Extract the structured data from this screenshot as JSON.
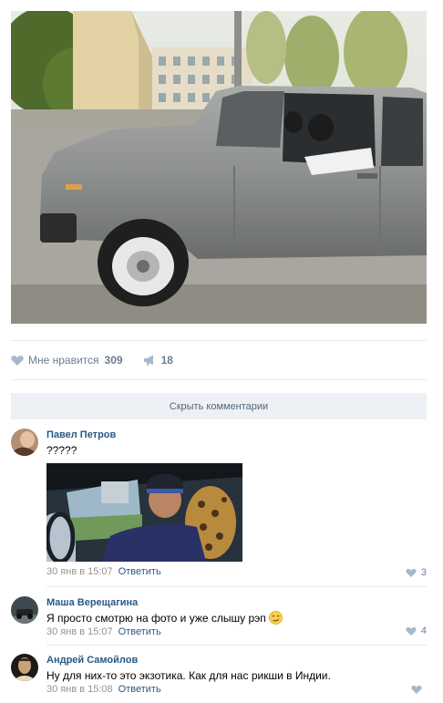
{
  "post": {
    "photo_icon": "post-photo-car",
    "likes_label": "Мне нравится",
    "likes_count": "309",
    "shares_count": "18"
  },
  "comments_toggle": "Скрыть комментарии",
  "comments": [
    {
      "author": "Павел Петров",
      "text": "?????",
      "date": "30 янв в 15:07",
      "reply": "Ответить",
      "likes": "3"
    },
    {
      "author": "Маша Верещагина",
      "text": "Я просто смотрю на фото и уже слышу рэп",
      "date": "30 янв в 15:07",
      "reply": "Ответить",
      "likes": "4"
    },
    {
      "author": "Андрей Самойлов",
      "text": "Ну для них-то это экзотика. Как для нас рикши в Индии.",
      "date": "30 янв в 15:08",
      "reply": "Ответить",
      "likes": ""
    }
  ],
  "colors": {
    "link": "#2a5885",
    "button_bg": "#edf0f4",
    "icon": "#5f7fa3"
  }
}
